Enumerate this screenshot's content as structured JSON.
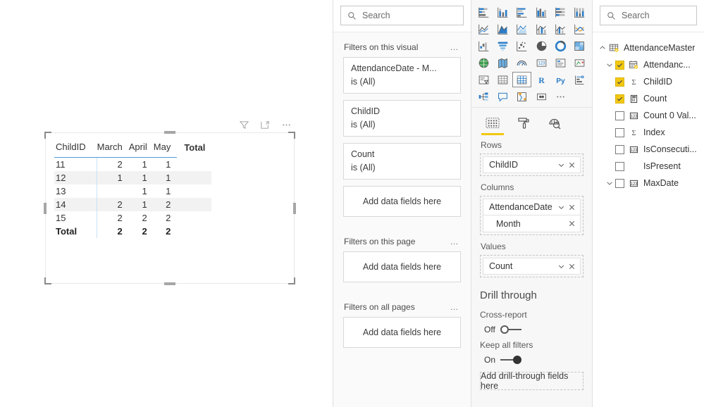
{
  "canvas": {
    "visual_header": {
      "filter_icon": "filter-icon",
      "focus_icon": "focus-mode-icon",
      "more_icon": "more-options-icon"
    },
    "matrix": {
      "type": "table",
      "row_header": "ChildID",
      "columns": [
        "March",
        "April",
        "May"
      ],
      "total_header": "Total",
      "rows": [
        {
          "label": "11",
          "values": [
            "2",
            "1",
            "1"
          ],
          "total": ""
        },
        {
          "label": "12",
          "values": [
            "1",
            "1",
            "1"
          ],
          "total": ""
        },
        {
          "label": "13",
          "values": [
            "",
            "1",
            "1"
          ],
          "total": ""
        },
        {
          "label": "14",
          "values": [
            "2",
            "1",
            "2"
          ],
          "total": ""
        },
        {
          "label": "15",
          "values": [
            "2",
            "2",
            "2"
          ],
          "total": ""
        }
      ],
      "total_row": {
        "label": "Total",
        "values": [
          "2",
          "2",
          "2"
        ],
        "total": ""
      }
    }
  },
  "filters_pane": {
    "search": {
      "placeholder": "Search",
      "icon": "search-icon"
    },
    "sections": [
      {
        "title": "Filters on this visual",
        "menu": "…",
        "cards": [
          {
            "name": "AttendanceDate - M...",
            "state": "is (All)"
          },
          {
            "name": "ChildID",
            "state": "is (All)"
          },
          {
            "name": "Count",
            "state": "is (All)"
          }
        ],
        "dropzone": "Add data fields here"
      },
      {
        "title": "Filters on this page",
        "menu": "…",
        "cards": [],
        "dropzone": "Add data fields here"
      },
      {
        "title": "Filters on all pages",
        "menu": "…",
        "cards": [],
        "dropzone": "Add data fields here"
      }
    ]
  },
  "viz_pane": {
    "gallery": [
      "stacked-bar-chart-icon",
      "stacked-column-chart-icon",
      "clustered-bar-chart-icon",
      "clustered-column-chart-icon",
      "hundred-percent-stacked-bar-chart-icon",
      "hundred-percent-stacked-column-chart-icon",
      "line-chart-icon",
      "area-chart-icon",
      "stacked-area-chart-icon",
      "line-stacked-column-chart-icon",
      "line-clustered-column-chart-icon",
      "ribbon-chart-icon",
      "waterfall-chart-icon",
      "funnel-chart-icon",
      "scatter-chart-icon",
      "pie-chart-icon",
      "donut-chart-icon",
      "treemap-icon",
      "map-icon",
      "filled-map-icon",
      "gauge-icon",
      "card-icon",
      "multi-row-card-icon",
      "kpi-icon",
      "slicer-icon",
      "table-icon",
      "matrix-icon",
      "r-script-visual-icon",
      "python-visual-icon",
      "key-influencers-icon",
      "decomposition-tree-icon",
      "q-and-a-icon",
      "smart-narrative-icon",
      "paginated-report-icon",
      "more-visuals-icon"
    ],
    "selected_visual": "matrix-icon",
    "tabs": [
      {
        "name": "fields-tab",
        "icon": "fields-icon",
        "active": true
      },
      {
        "name": "format-tab",
        "icon": "paint-roller-icon",
        "active": false
      },
      {
        "name": "analytics-tab",
        "icon": "analytics-magnifier-icon",
        "active": false
      }
    ],
    "wells": [
      {
        "label": "Rows",
        "items": [
          {
            "name": "ChildID",
            "has_chevron": true,
            "has_remove": true,
            "sub": null
          }
        ]
      },
      {
        "label": "Columns",
        "items": [
          {
            "name": "AttendanceDate",
            "has_chevron": true,
            "has_remove": true,
            "sub": "Month"
          }
        ]
      },
      {
        "label": "Values",
        "items": [
          {
            "name": "Count",
            "has_chevron": true,
            "has_remove": true,
            "sub": null
          }
        ]
      }
    ],
    "drill_through": {
      "title": "Drill through",
      "cross_report_label": "Cross-report",
      "cross_report_state": "Off",
      "cross_report_on": false,
      "keep_filters_label": "Keep all filters",
      "keep_filters_state": "On",
      "keep_filters_on": true,
      "dropzone": "Add drill-through fields here"
    }
  },
  "fields_pane": {
    "search": {
      "placeholder": "Search",
      "icon": "search-icon"
    },
    "tree": [
      {
        "label": "AttendanceMaster",
        "level": 0,
        "chevron": "up",
        "checkbox": "none",
        "icon": "table-icon",
        "badge": true
      },
      {
        "label": "Attendanc...",
        "level": 1,
        "chevron": "down",
        "checkbox": "checked",
        "icon": "calendar-icon",
        "badge": true
      },
      {
        "label": "ChildID",
        "level": 2,
        "chevron": "none",
        "checkbox": "checked",
        "icon": "sigma-icon",
        "badge": false
      },
      {
        "label": "Count",
        "level": 2,
        "chevron": "none",
        "checkbox": "checked",
        "icon": "measure-icon",
        "badge": false
      },
      {
        "label": "Count 0 Val...",
        "level": 2,
        "chevron": "none",
        "checkbox": "unchecked",
        "icon": "number-icon",
        "badge": false
      },
      {
        "label": "Index",
        "level": 2,
        "chevron": "none",
        "checkbox": "unchecked",
        "icon": "sigma-icon",
        "badge": false
      },
      {
        "label": "IsConsecuti...",
        "level": 2,
        "chevron": "none",
        "checkbox": "unchecked",
        "icon": "number-icon",
        "badge": false
      },
      {
        "label": "IsPresent",
        "level": 2,
        "chevron": "none",
        "checkbox": "unchecked",
        "icon": "none",
        "badge": false
      },
      {
        "label": "MaxDate",
        "level": 1,
        "chevron": "down",
        "checkbox": "unchecked",
        "icon": "number-icon",
        "badge": false
      }
    ]
  },
  "colors": {
    "accent_yellow": "#f2c811",
    "matrix_underline": "#4f9bd9",
    "pane_bg": "#f7f7f7",
    "alt_row": "#f2f2f2"
  }
}
